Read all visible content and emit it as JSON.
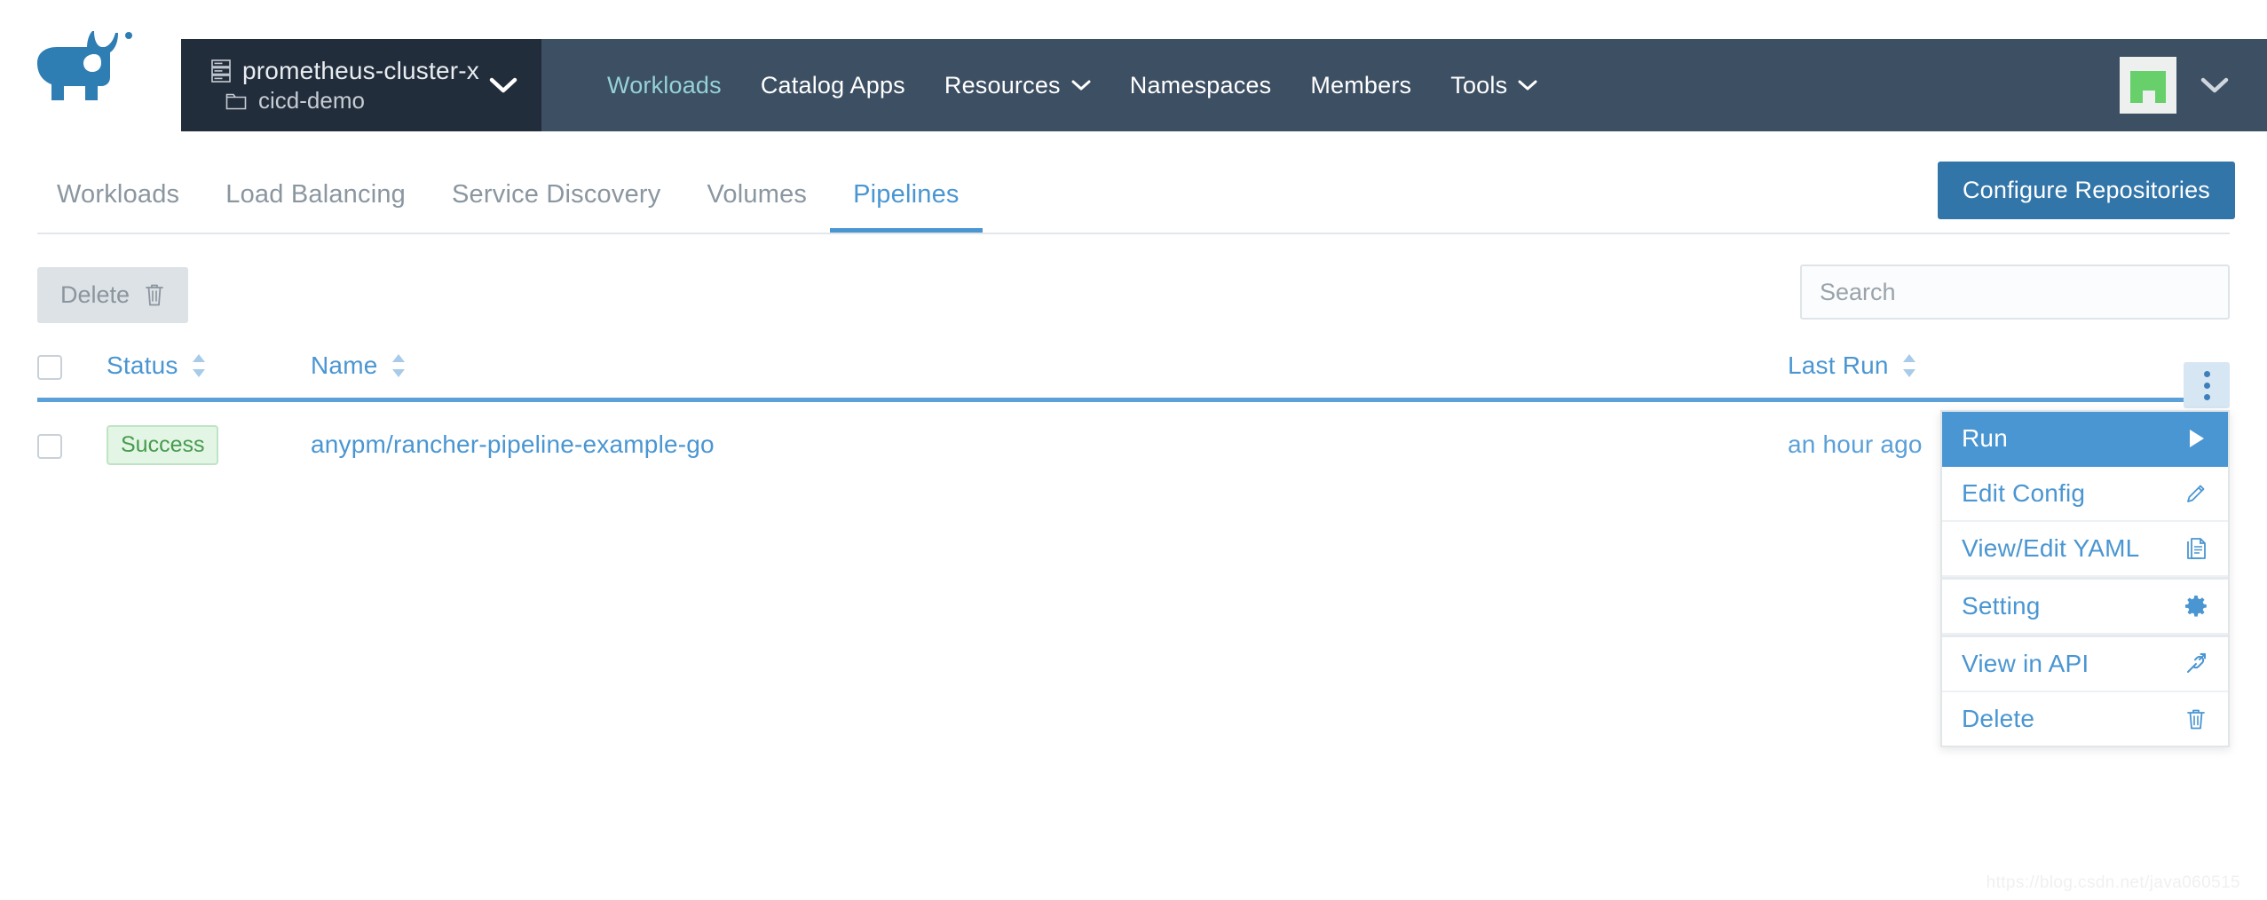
{
  "brand": {
    "logo_alt": "rancher-logo"
  },
  "cluster_selector": {
    "cluster_name": "prometheus-cluster-x",
    "project_name": "cicd-demo",
    "cluster_icon": "server-icon",
    "project_icon": "folder-icon",
    "caret_icon": "chevron-down-icon"
  },
  "nav": {
    "items": [
      {
        "label": "Workloads",
        "active": true,
        "caret": false
      },
      {
        "label": "Catalog Apps",
        "active": false,
        "caret": false
      },
      {
        "label": "Resources",
        "active": false,
        "caret": true
      },
      {
        "label": "Namespaces",
        "active": false,
        "caret": false
      },
      {
        "label": "Members",
        "active": false,
        "caret": false
      },
      {
        "label": "Tools",
        "active": false,
        "caret": true
      }
    ],
    "active_color": "#95d2d6",
    "bar_color": "#3d4f63",
    "selector_color": "#222d3b"
  },
  "user": {
    "avatar_icon": "user-avatar",
    "avatar_color": "#67d06a",
    "caret_icon": "chevron-down-icon"
  },
  "tabs": {
    "items": [
      {
        "label": "Workloads",
        "active": false
      },
      {
        "label": "Load Balancing",
        "active": false
      },
      {
        "label": "Service Discovery",
        "active": false
      },
      {
        "label": "Volumes",
        "active": false
      },
      {
        "label": "Pipelines",
        "active": true
      }
    ],
    "active_color": "#4a96d2"
  },
  "actions": {
    "configure_repositories": "Configure Repositories",
    "configure_repositories_color": "#3275a8",
    "delete_label": "Delete",
    "delete_icon": "trash-icon"
  },
  "search": {
    "value": "",
    "placeholder": "Search"
  },
  "table": {
    "columns": [
      {
        "label": "Status",
        "sortable": true
      },
      {
        "label": "Name",
        "sortable": true
      },
      {
        "label": "Last Run",
        "sortable": true
      }
    ],
    "rows": [
      {
        "status": "Success",
        "status_color": "#479b4f",
        "status_bg": "#e3f5e4",
        "name": "anypm/rancher-pipeline-example-go",
        "last_run": "an hour ago"
      }
    ]
  },
  "action_menu": {
    "trigger_icon": "kebab-menu-icon",
    "items": [
      {
        "label": "Run",
        "icon": "play-icon",
        "highlight": true,
        "divider_above": false
      },
      {
        "label": "Edit Config",
        "icon": "pencil-icon",
        "highlight": false,
        "divider_above": false
      },
      {
        "label": "View/Edit YAML",
        "icon": "document-icon",
        "highlight": false,
        "divider_above": false
      },
      {
        "label": "Setting",
        "icon": "gear-icon",
        "highlight": false,
        "divider_above": true
      },
      {
        "label": "View in API",
        "icon": "link-external-icon",
        "highlight": false,
        "divider_above": true
      },
      {
        "label": "Delete",
        "icon": "trash-icon",
        "highlight": false,
        "divider_above": false
      }
    ]
  },
  "watermark": {
    "text": "https://blog.csdn.net/java060515"
  }
}
